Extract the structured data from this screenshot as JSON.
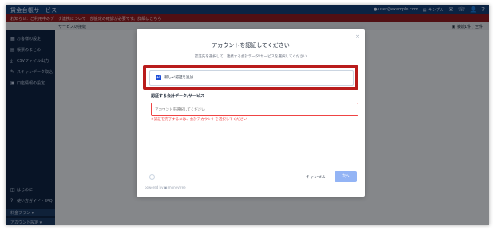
{
  "app": {
    "brand": "賃金台帳サービス",
    "top_user": "● user@example.com",
    "top_org": "▤ サンプル"
  },
  "banners": {
    "alert": "お知らせ：ご利用中のデータ連携について一部設定の確認が必要です。詳細はこちら",
    "page_title": "サービスの接続",
    "right_info": "▣ 接続1件 / 全件"
  },
  "sidebar": {
    "items": [
      {
        "icon": "▦",
        "label": "お客様の設定"
      },
      {
        "icon": "▤",
        "label": "帳票のまとめ"
      },
      {
        "icon": "⤓",
        "label": "CSVファイル出力"
      },
      {
        "icon": "✎",
        "label": "スキャンデータ取込"
      },
      {
        "icon": "▣",
        "label": "口座情報の設定"
      }
    ],
    "bottom_items": [
      {
        "icon": "◫",
        "label": "はじめに"
      },
      {
        "icon": "?",
        "label": "使い方ガイド・FAQ"
      }
    ],
    "footer": [
      {
        "label": "料金プラン ▾"
      },
      {
        "label": "アカウント設定 ▾"
      }
    ]
  },
  "modal": {
    "close": "×",
    "title": "アカウントを認証してください",
    "description": "認証先を選択して、連携する会計データ/サービスを選択してください",
    "option": {
      "icon": "⇄",
      "label": "新しい認証を追加"
    },
    "section_label": "認証する会計データ/サービス",
    "input_placeholder": "アカウントを選択してください",
    "error": "※認証を完了するには、会計アカウントを選択してください",
    "powered_by": "powered by ▣ moneytree",
    "cancel": "キャンセル",
    "next": "次へ"
  },
  "colors": {
    "topbar": "#123d74",
    "alert": "#8b1b22",
    "sidebar": "#0f2442",
    "highlight": "#b91c1c",
    "primary_disabled": "#93b4f5"
  }
}
